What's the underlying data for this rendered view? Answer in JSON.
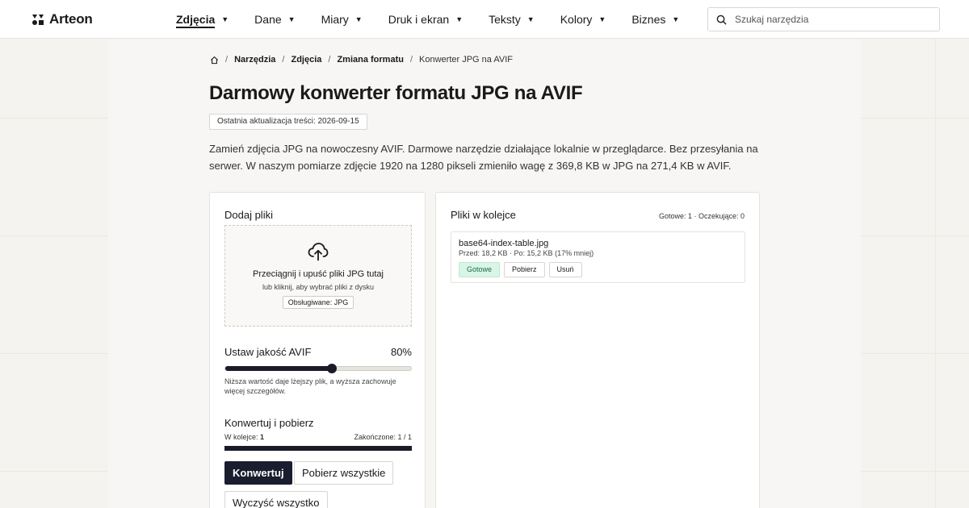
{
  "brand": {
    "name": "Arteon"
  },
  "nav": {
    "items": [
      {
        "label": "Zdjęcia",
        "active": true
      },
      {
        "label": "Dane"
      },
      {
        "label": "Miary"
      },
      {
        "label": "Druk i ekran"
      },
      {
        "label": "Teksty"
      },
      {
        "label": "Kolory"
      },
      {
        "label": "Biznes"
      }
    ]
  },
  "search": {
    "placeholder": "Szukaj narzędzia"
  },
  "breadcrumb": {
    "items": [
      "Narzędzia",
      "Zdjęcia",
      "Zmiana formatu"
    ],
    "current": "Konwerter JPG na AVIF"
  },
  "page": {
    "title": "Darmowy konwerter formatu JPG na AVIF",
    "updated": "Ostatnia aktualizacja treści: 2026-09-15",
    "description": "Zamień zdjęcia JPG na nowoczesny AVIF. Darmowe narzędzie działające lokalnie w przeglądarce. Bez przesyłania na serwer. W naszym pomiarze zdjęcie 1920 na 1280 pikseli zmieniło wagę z 369,8 KB w JPG na 271,4 KB w AVIF."
  },
  "upload": {
    "title": "Dodaj pliki",
    "drop_main": "Przeciągnij i upuść pliki JPG tutaj",
    "drop_sub": "lub kliknij, aby wybrać pliki z dysku",
    "supported": "Obsługiwane: JPG"
  },
  "quality": {
    "label": "Ustaw jakość AVIF",
    "value_text": "80%",
    "value": 80,
    "help": "Niższa wartość daje lżejszy plik, a wyższa zachowuje więcej szczegółów."
  },
  "convert": {
    "title": "Konwertuj i pobierz",
    "queue_label": "W kolejce:",
    "queue_count": "1",
    "done_label": "Zakończone: 1 / 1",
    "progress": 1.0,
    "convert_button": "Konwertuj",
    "download_all_button": "Pobierz wszystkie",
    "clear_button": "Wyczyść wszystko"
  },
  "queue": {
    "title": "Pliki w kolejce",
    "status": "Gotowe: 1 · Oczekujące: 0",
    "files": [
      {
        "name": "base64-index-table.jpg",
        "meta": "Przed: 18,2 KB · Po: 15,2 KB (17% mniej)",
        "status": "Gotowe",
        "download": "Pobierz",
        "remove": "Usuń"
      }
    ]
  },
  "colors": {
    "accent": "#1a1d2e",
    "success_bg": "#d9f5e6",
    "page_bg": "#f5f3ef"
  },
  "icons": [
    "logo-icon",
    "chevron-down-icon",
    "search-icon",
    "home-icon",
    "cloud-upload-icon"
  ]
}
